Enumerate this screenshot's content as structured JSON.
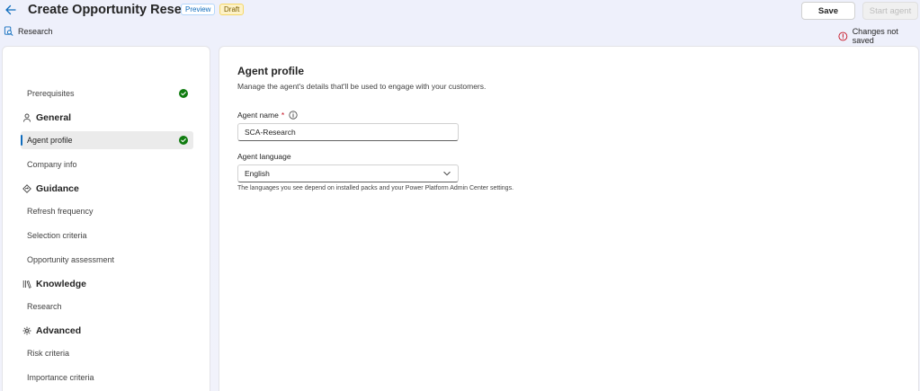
{
  "header": {
    "title": "Create Opportunity Research",
    "badge_preview": "Preview",
    "badge_draft": "Draft",
    "save_label": "Save",
    "start_label": "Start agent",
    "breadcrumb": "Research",
    "status_text": "Changes not saved"
  },
  "sidebar": {
    "prerequisites": "Prerequisites",
    "groups": {
      "general": "General",
      "guidance": "Guidance",
      "knowledge": "Knowledge",
      "advanced": "Advanced"
    },
    "items": {
      "agent_profile": "Agent profile",
      "company_info": "Company info",
      "refresh_frequency": "Refresh frequency",
      "selection_criteria": "Selection criteria",
      "opportunity_assessment": "Opportunity assessment",
      "research": "Research",
      "risk_criteria": "Risk criteria",
      "importance_criteria": "Importance criteria"
    }
  },
  "main": {
    "title": "Agent profile",
    "description": "Manage the agent's details that'll be used to engage with your customers.",
    "agent_name_label": "Agent name",
    "required_mark": "*",
    "agent_name_value": "SCA-Research",
    "agent_language_label": "Agent language",
    "agent_language_value": "English",
    "language_hint": "The languages you see depend on installed packs and your Power Platform Admin Center settings."
  },
  "colors": {
    "accent": "#0f6cbd",
    "success": "#107c10",
    "error": "#c50f1f"
  }
}
